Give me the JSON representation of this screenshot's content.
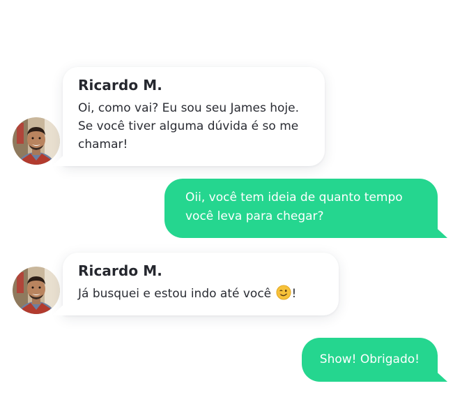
{
  "conversation": {
    "messages": [
      {
        "direction": "incoming",
        "sender": "Ricardo M.",
        "text": "Oi, como vai? Eu sou seu James hoje. Se você tiver alguma dúvida é so me chamar!"
      },
      {
        "direction": "outgoing",
        "text": "Oii, você tem ideia de quanto tempo você leva para chegar?"
      },
      {
        "direction": "incoming",
        "sender": "Ricardo M.",
        "text_before_emoji": "Já busquei e estou indo até você",
        "emoji": "winking-face",
        "text_after_emoji": "!"
      },
      {
        "direction": "outgoing",
        "text": "Show! Obrigado!"
      }
    ]
  },
  "colors": {
    "outgoing_bubble": "#25d68f",
    "incoming_bubble": "#ffffff",
    "text_dark": "#25272e"
  }
}
